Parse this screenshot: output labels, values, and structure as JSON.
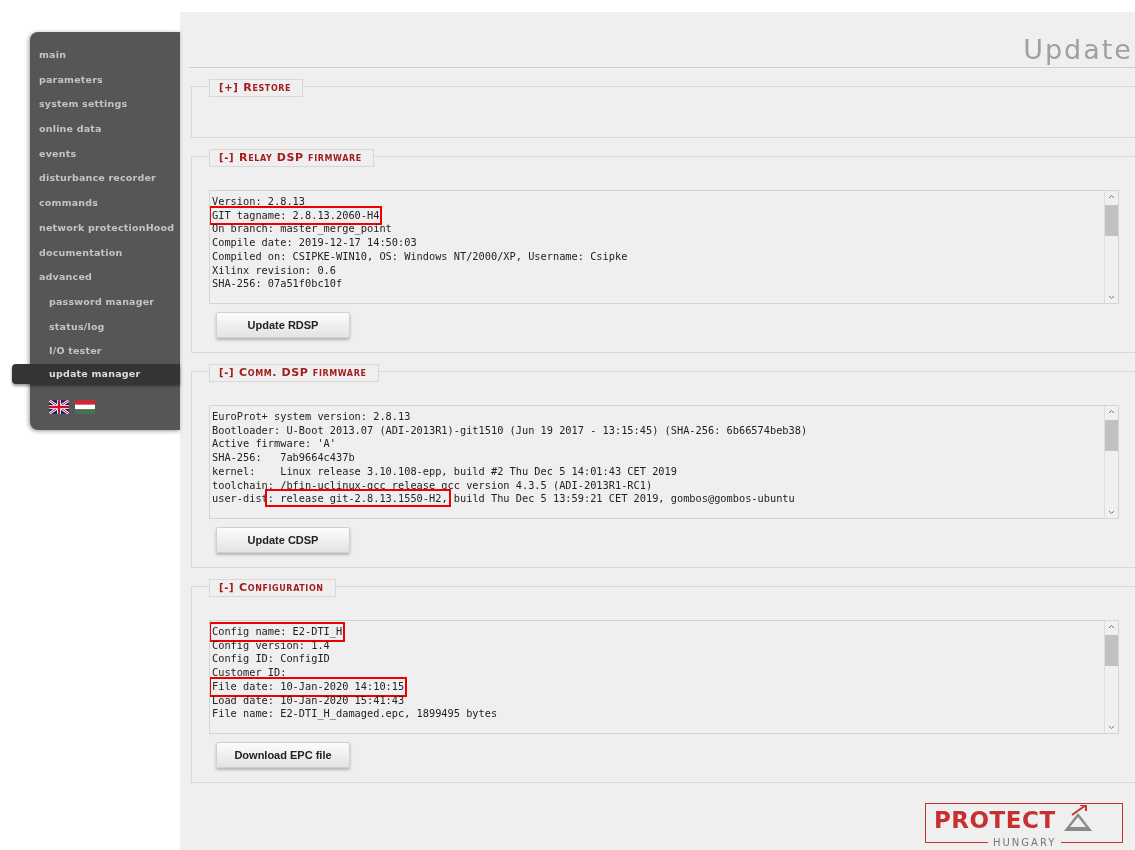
{
  "sidebar": {
    "items": [
      {
        "label": "main",
        "selected": false
      },
      {
        "label": "parameters",
        "selected": false
      },
      {
        "label": "system settings",
        "selected": false
      },
      {
        "label": "online data",
        "selected": false
      },
      {
        "label": "events",
        "selected": false
      },
      {
        "label": "disturbance recorder",
        "selected": false
      },
      {
        "label": "commands",
        "selected": false
      },
      {
        "label": "network protectionHood",
        "selected": false
      },
      {
        "label": "documentation",
        "selected": false
      },
      {
        "label": "advanced",
        "selected": false,
        "children": [
          {
            "label": "password manager",
            "selected": false
          },
          {
            "label": "status/log",
            "selected": false
          },
          {
            "label": "I/O tester",
            "selected": false
          },
          {
            "label": "update manager",
            "selected": true
          }
        ]
      }
    ],
    "languages": [
      {
        "kind": "uk"
      },
      {
        "kind": "hu"
      }
    ]
  },
  "page_title": "Update",
  "sections": [
    {
      "toggle": "[+]",
      "title": "Restore",
      "expanded": false
    },
    {
      "toggle": "[-]",
      "title": "Relay DSP firmware",
      "expanded": true,
      "lines": [
        [
          {
            "text": "Version: 2.8.13",
            "highlighted": false
          }
        ],
        [
          {
            "text": "GIT tagname: 2.8.13.2060-H4",
            "highlighted": true
          }
        ],
        [
          {
            "text": "On branch: master_merge_point",
            "highlighted": false
          }
        ],
        [
          {
            "text": "Compile date: 2019-12-17 14:50:03",
            "highlighted": false
          }
        ],
        [
          {
            "text": "Compiled on: CSIPKE-WIN10, OS: Windows NT/2000/XP, Username: Csipke",
            "highlighted": false
          }
        ],
        [
          {
            "text": "Xilinx revision: 0.6",
            "highlighted": false
          }
        ],
        [
          {
            "text": "SHA-256: 07a51f0bc10f",
            "highlighted": false
          }
        ]
      ],
      "button": "Update RDSP"
    },
    {
      "toggle": "[-]",
      "title": "Comm. DSP firmware",
      "expanded": true,
      "lines": [
        [
          {
            "text": "EuroProt+ system version: 2.8.13",
            "highlighted": false
          }
        ],
        [
          {
            "text": "Bootloader: U-Boot 2013.07 (ADI-2013R1)-git1510 (Jun 19 2017 - 13:15:45) (SHA-256: 6b66574beb38)",
            "highlighted": false
          }
        ],
        [
          {
            "text": "Active firmware: 'A'",
            "highlighted": false
          }
        ],
        [
          {
            "text": "SHA-256:   7ab9664c437b",
            "highlighted": false
          }
        ],
        [
          {
            "text": "kernel:    Linux release 3.10.108-epp, build #2 Thu Dec 5 14:01:43 CET 2019",
            "highlighted": false
          }
        ],
        [
          {
            "text": "toolchain: /bfin-uclinux-gcc release gcc version 4.3.5 (ADI-2013R1-RC1)",
            "highlighted": false
          }
        ],
        [
          {
            "text": "user-dist",
            "highlighted": false
          },
          {
            "text": ": release git-2.8.13.1550-H2,",
            "highlighted": true
          },
          {
            "text": " build Thu Dec 5 13:59:21 CET 2019, gombos@gombos-ubuntu",
            "highlighted": false
          }
        ]
      ],
      "button": "Update CDSP"
    },
    {
      "toggle": "[-]",
      "title": "Configuration",
      "expanded": true,
      "lines": [
        [
          {
            "text": "Config name: E2-DTI_H",
            "highlighted": true
          }
        ],
        [
          {
            "text": "Config version: 1.4",
            "highlighted": false
          }
        ],
        [
          {
            "text": "Config ID: ConfigID",
            "highlighted": false
          }
        ],
        [
          {
            "text": "Customer ID:",
            "highlighted": false
          }
        ],
        [
          {
            "text": "File date: 10-Jan-2020 14:10:15",
            "highlighted": true
          }
        ],
        [
          {
            "text": "Load date: 10-Jan-2020 15:41:43",
            "highlighted": false
          }
        ],
        [
          {
            "text": "File name: E2-DTI_H_damaged.epc, 1899495 bytes",
            "highlighted": false
          }
        ]
      ],
      "button": "Download EPC file"
    }
  ],
  "logo": {
    "name": "PROTECT",
    "subtitle": "HUNGARY"
  }
}
